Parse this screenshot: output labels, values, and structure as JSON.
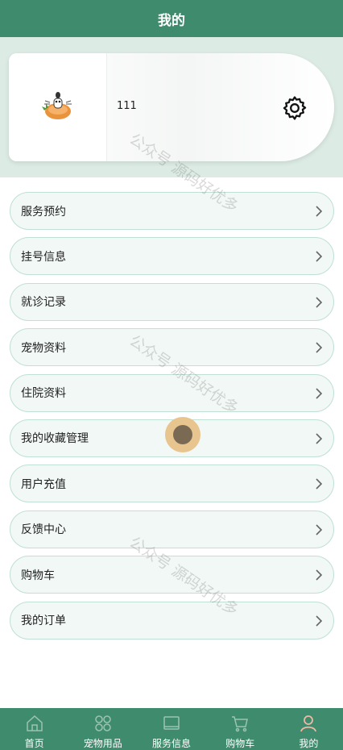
{
  "header": {
    "title": "我的"
  },
  "profile": {
    "username": "111"
  },
  "menu": {
    "items": [
      {
        "label": "服务预约"
      },
      {
        "label": "挂号信息"
      },
      {
        "label": "就诊记录"
      },
      {
        "label": "宠物资料"
      },
      {
        "label": "住院资料"
      },
      {
        "label": "我的收藏管理"
      },
      {
        "label": "用户充值"
      },
      {
        "label": "反馈中心"
      },
      {
        "label": "购物车"
      },
      {
        "label": "我的订单"
      }
    ]
  },
  "tabbar": {
    "tabs": [
      {
        "label": "首页",
        "icon": "home-icon"
      },
      {
        "label": "宠物用品",
        "icon": "grid-icon"
      },
      {
        "label": "服务信息",
        "icon": "window-icon"
      },
      {
        "label": "购物车",
        "icon": "cart-icon"
      },
      {
        "label": "我的",
        "icon": "user-icon"
      }
    ]
  },
  "watermark": {
    "text": "公众号 源码好优多"
  },
  "colors": {
    "brand_green": "#3f8b6d",
    "active_tab": "#f0b8a6",
    "menu_bg": "#f1f8f5",
    "menu_border": "#bfe0d3"
  }
}
